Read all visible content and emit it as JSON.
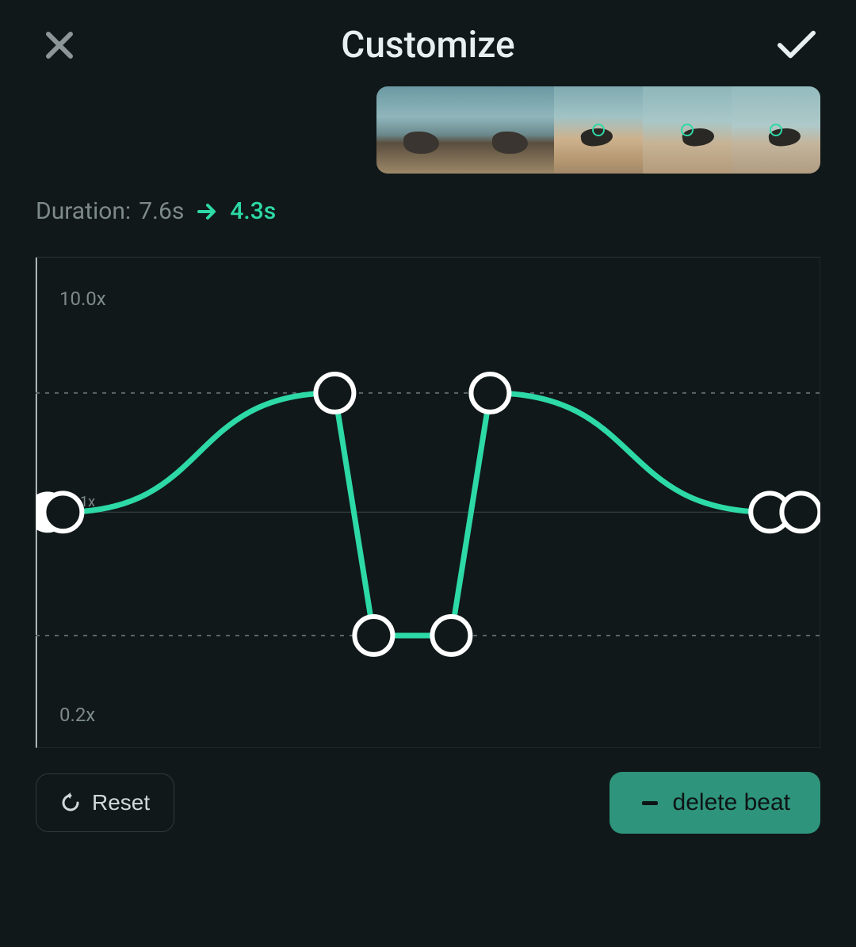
{
  "header": {
    "title": "Customize"
  },
  "duration": {
    "label": "Duration:",
    "from": "7.6s",
    "to": "4.3s"
  },
  "chart_data": {
    "type": "line",
    "title": "",
    "xlabel": "",
    "ylabel": "",
    "y_ticks": [
      {
        "label": "10.0x",
        "value": 10.0
      },
      {
        "label": "1x",
        "value": 1.0
      },
      {
        "label": "0.2x",
        "value": 0.2
      }
    ],
    "ylim": [
      0.1,
      12
    ],
    "guides": [
      0.3,
      3.2
    ],
    "points": [
      {
        "t": 0.0,
        "speed": 1.0
      },
      {
        "t": 0.03,
        "speed": 1.0
      },
      {
        "t": 0.38,
        "speed": 3.2
      },
      {
        "t": 0.43,
        "speed": 0.3
      },
      {
        "t": 0.53,
        "speed": 0.3
      },
      {
        "t": 0.58,
        "speed": 3.2
      },
      {
        "t": 0.94,
        "speed": 1.0
      },
      {
        "t": 0.98,
        "speed": 1.0
      }
    ]
  },
  "buttons": {
    "reset": "Reset",
    "delete_beat": "delete beat"
  },
  "colors": {
    "accent": "#2dd9a6",
    "accent_dark": "#2e947b",
    "bg": "#10181a"
  },
  "filmstrip": {
    "frame_count": 5
  }
}
